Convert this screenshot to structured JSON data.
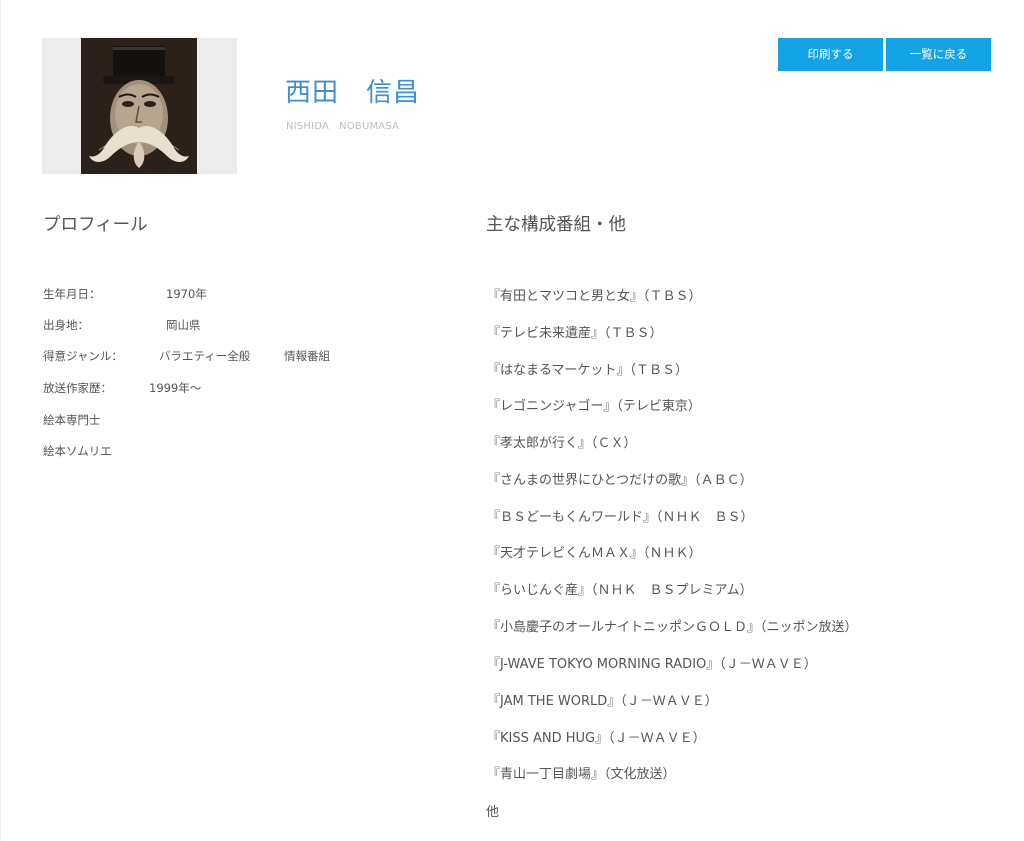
{
  "header": {
    "name": "西田　信昌",
    "romaji": "NISHIDA   NOBUMASA",
    "print_button": "印刷する",
    "back_button": "一覧に戻る"
  },
  "profile": {
    "title": "プロフィール",
    "rows": [
      {
        "label": "生年月日：",
        "value": "1970年"
      },
      {
        "label": "出身地：",
        "value": "岡山県"
      },
      {
        "label": "得意ジャンル：",
        "value": "バラエティー全般",
        "value2": "情報番組"
      },
      {
        "label": "放送作家歴：",
        "value": "1999年〜"
      },
      {
        "label": "絵本専門士"
      },
      {
        "label": "絵本ソムリエ"
      }
    ]
  },
  "works": {
    "title": "主な構成番組・他",
    "items": [
      "『有田とマツコと男と女』（ＴＢＳ）",
      "『テレビ未来遺産』（ＴＢＳ）",
      "『はなまるマーケット』（ＴＢＳ）",
      "『レゴニンジャゴー』（テレビ東京）",
      "『孝太郎が行く』（ＣＸ）",
      "『さんまの世界にひとつだけの歌』（ＡＢＣ）",
      "『ＢＳどーもくんワールド』（ＮＨＫ　ＢＳ）",
      "『天才テレビくんＭＡＸ』（ＮＨＫ）",
      "『らいじんぐ産』（ＮＨＫ　ＢＳプレミアム）",
      "『小島慶子のオールナイトニッポンＧＯＬＤ』（ニッポン放送）",
      "『J-WAVE TOKYO MORNING RADIO』（Ｊ－ＷＡＶＥ）",
      "『JAM THE WORLD』（Ｊ－ＷＡＶＥ）",
      "『KISS AND HUG』（Ｊ－ＷＡＶＥ）",
      "『青山一丁目劇場』（文化放送）",
      "他"
    ]
  }
}
